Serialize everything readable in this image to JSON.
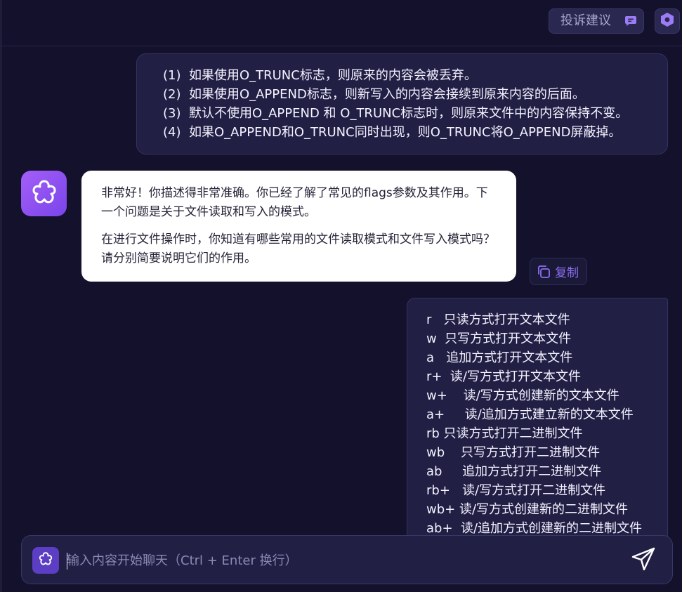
{
  "header": {
    "feedback_label": "投诉建议",
    "feedback_icon": "chat-message-icon",
    "settings_icon": "hexagon-settings-icon"
  },
  "messages": {
    "user_1": {
      "lines": [
        "(1)  如果使用O_TRUNC标志，则原来的内容会被丢弃。",
        "(2)  如果使用O_APPEND标志，则新写入的内容会接续到原来内容的后面。",
        "(3)  默认不使用O_APPEND 和 O_TRUNC标志时，则原来文件中的内容保持不变。",
        "(4)  如果O_APPEND和O_TRUNC同时出现，则O_TRUNC将O_APPEND屏蔽掉。"
      ]
    },
    "assistant_1": {
      "paragraph_1": "非常好！你描述得非常准确。你已经了解了常见的flags参数及其作用。下一个问题是关于文件读取和写入的模式。",
      "paragraph_2": "在进行文件操作时，你知道有哪些常用的文件读取模式和文件写入模式吗？请分别简要说明它们的作用。",
      "copy_label": "复制"
    },
    "user_2": {
      "lines": [
        "r   只读方式打开文本文件",
        "w  只写方式打开文本文件",
        "a   追加方式打开文本文件",
        "r+  读/写方式打开文本文件",
        "w+    读/写方式创建新的文本文件",
        "a+     读/追加方式建立新的文本文件",
        "rb 只读方式打开二进制文件",
        "wb    只写方式打开二进制文件",
        "ab     追加方式打开二进制文件",
        "rb+   读/写方式打开二进制文件",
        "wb+ 读/写方式创建新的二进制文件",
        "ab+  读/追加方式创建新的二进制文件"
      ]
    }
  },
  "input": {
    "placeholder": "输入内容开始聊天（Ctrl + Enter 换行）",
    "value": ""
  },
  "colors": {
    "background": "#13112b",
    "user_bubble": "#221f45",
    "assistant_bubble": "#ffffff",
    "accent": "#8d6ff2",
    "avatar_gradient_start": "#a45ef7",
    "avatar_gradient_end": "#7a45ea"
  }
}
